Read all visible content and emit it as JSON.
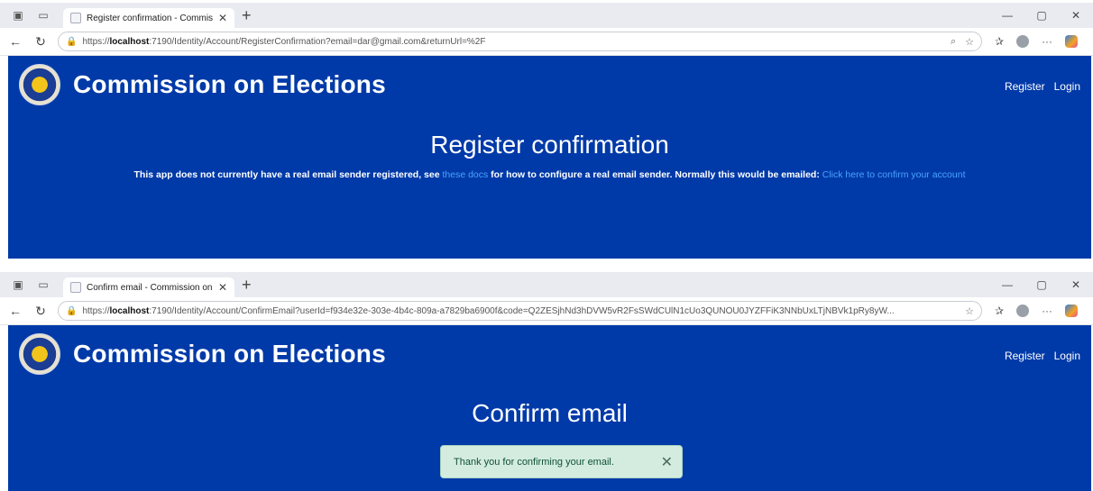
{
  "windows": [
    {
      "tab_title": "Register confirmation - Commissi",
      "url_prefix": "https://",
      "url_host": "localhost",
      "url_rest": ":7190/Identity/Account/RegisterConfirmation?email=dar@gmail.com&returnUrl=%2F",
      "brand": "Commission on Elections",
      "nav": {
        "register": "Register",
        "login": "Login"
      },
      "page_title": "Register confirmation",
      "message": {
        "part1": "This app does not currently have a real email sender registered, see ",
        "link1": "these docs",
        "part2": " for how to configure a real email sender. Normally this would be emailed: ",
        "link2": "Click here to confirm your account"
      }
    },
    {
      "tab_title": "Confirm email - Commission on E",
      "url_prefix": "https://",
      "url_host": "localhost",
      "url_rest": ":7190/Identity/Account/ConfirmEmail?userId=f934e32e-303e-4b4c-809a-a7829ba6900f&code=Q2ZESjhNd3hDVW5vR2FsSWdCUlN1cUo3QUNOU0JYZFFiK3NNbUxLTjNBVk1pRy8yW...",
      "brand": "Commission on Elections",
      "nav": {
        "register": "Register",
        "login": "Login"
      },
      "page_title": "Confirm email",
      "alert": "Thank you for confirming your email."
    }
  ],
  "icons": {
    "tab_actions": "tab-actions-icon",
    "vertical_tabs": "vertical-tabs-icon",
    "close": "close-icon",
    "new_tab": "new-tab-icon",
    "back": "back-arrow-icon",
    "refresh": "refresh-icon",
    "lock": "lock-icon",
    "favorite": "star-icon",
    "favorites": "favorites-icon",
    "more": "more-icon",
    "copilot": "copilot-icon"
  },
  "colors": {
    "header_blue": "#003aa8",
    "link": "#4aa3ff",
    "alert_bg": "#d4ece0",
    "alert_text": "#0f5132"
  }
}
